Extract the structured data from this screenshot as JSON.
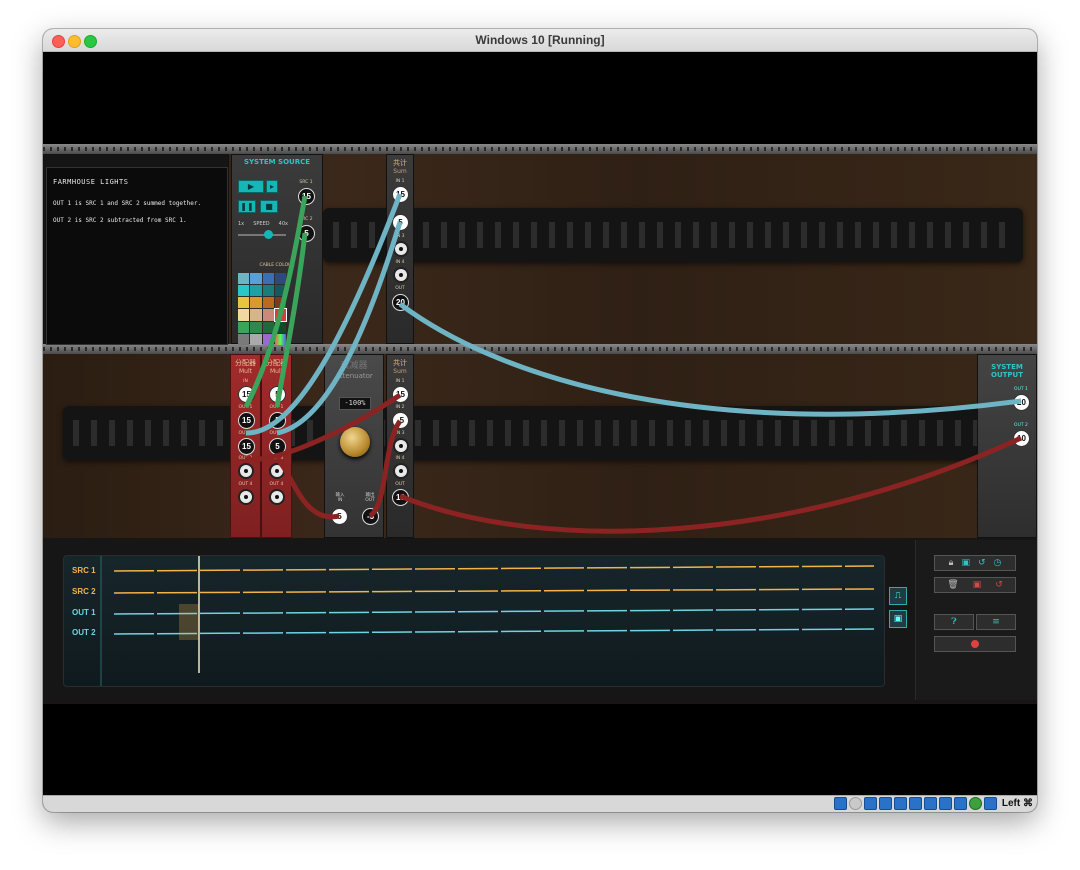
{
  "window": {
    "title": "Windows 10 [Running]"
  },
  "statusbar": {
    "host_key": "Left ⌘"
  },
  "notes": {
    "title": "FARMHOUSE LIGHTS",
    "line1": "OUT 1 is SRC 1 and SRC 2 summed together.",
    "line2": "OUT 2 is SRC 2 subtracted from SRC 1."
  },
  "system_source": {
    "title": "SYSTEM SOURCE",
    "src1_label": "SRC 1",
    "src1_value": "15",
    "src2_label": "SRC 2",
    "src2_value": "5",
    "speed_min": "1x",
    "speed_label": "SPEED",
    "speed_max": "40x",
    "cable_colour_label": "CABLE COLOUR"
  },
  "sum_top": {
    "title_cn": "共计",
    "title": "Sum",
    "in1": "IN 1",
    "in1_value": "15",
    "in2_value": "5",
    "in3": "IN 3",
    "in4": "IN 4",
    "out": "OUT",
    "out_value": "20"
  },
  "mult1": {
    "title_cn": "分配器",
    "title": "Mult",
    "in": "IN",
    "in_value": "15",
    "out1": "OUT 1",
    "out1_value": "15",
    "out2": "OUT 2",
    "out2_value": "15",
    "out3": "OUT 3",
    "out4": "OUT 4"
  },
  "mult2": {
    "title_cn": "分配器",
    "title": "Mult",
    "in_value": "5",
    "out1": "OUT 1",
    "out1_value": "5",
    "out2": "OUT 2",
    "out2_value": "5",
    "out3": "OUT 3",
    "out4": "OUT 4"
  },
  "attenuator": {
    "title_cn": "衰减器",
    "title": "Attenuator",
    "display": "-100%",
    "in_cn": "输入",
    "in": "IN",
    "in_value": "5",
    "out_cn": "输出",
    "out": "OUT",
    "out_value": "-5"
  },
  "sum_bottom": {
    "title_cn": "共计",
    "title": "Sum",
    "in1": "IN 1",
    "in1_value": "15",
    "in2": "IN 2",
    "in2_value": "-5",
    "in3": "IN 3",
    "in4": "IN 4",
    "out": "OUT",
    "out_value": "10"
  },
  "system_output": {
    "title": "SYSTEM OUTPUT",
    "out1": "OUT 1",
    "out1_value": "20",
    "out2": "OUT 2",
    "out2_value": "10"
  },
  "timeline": {
    "rows": [
      {
        "label": "SRC 1",
        "color": "#f3b34a"
      },
      {
        "label": "SRC 2",
        "color": "#f3b34a"
      },
      {
        "label": "OUT 1",
        "color": "#6fd4e0"
      },
      {
        "label": "OUT 2",
        "color": "#6fd4e0"
      }
    ]
  },
  "colors": {
    "teal_cable": "#6fb4c4",
    "green_cable": "#3aa55a",
    "red_cable": "#8c2323",
    "accent_teal": "#14b6b6"
  }
}
